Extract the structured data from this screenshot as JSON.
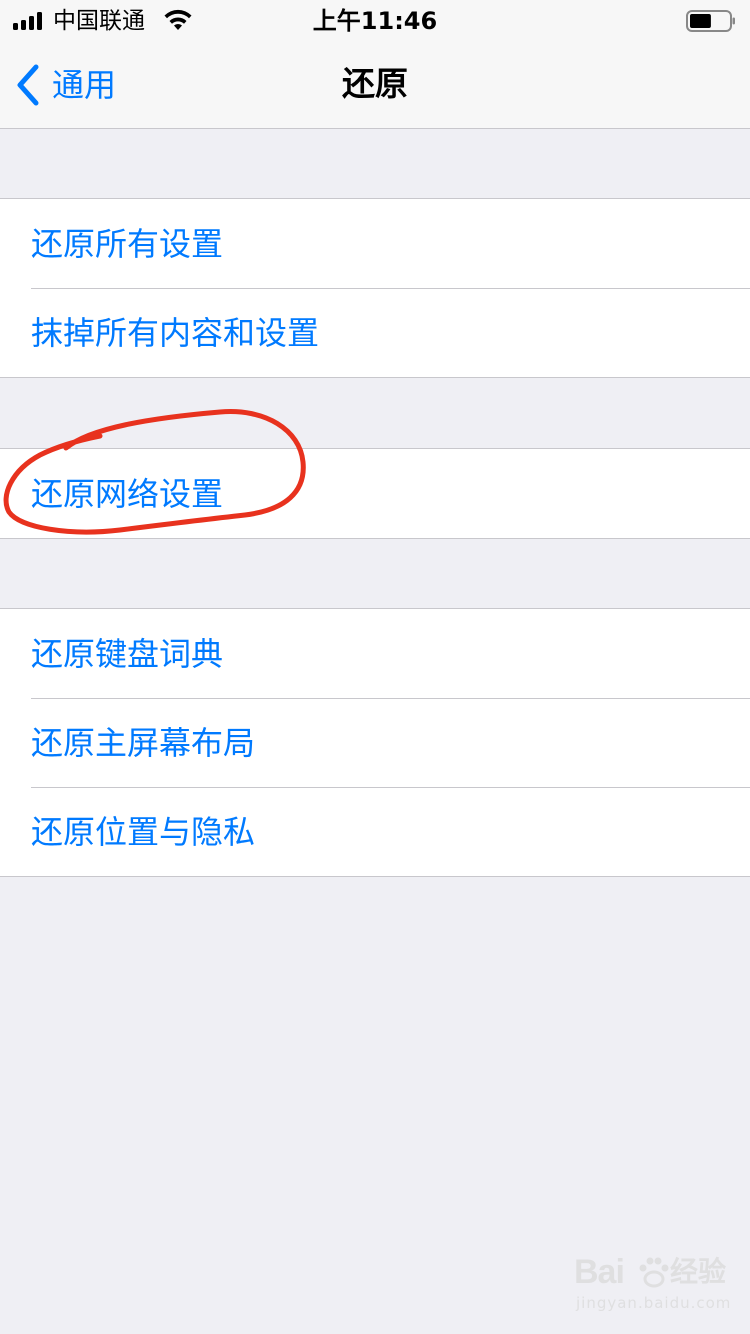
{
  "status_bar": {
    "carrier": "中国联通",
    "time": "上午11:46",
    "signal_bars": 4,
    "battery_level": 0.55
  },
  "nav": {
    "back_label": "通用",
    "title": "还原"
  },
  "groups": [
    {
      "items": [
        {
          "label": "还原所有设置"
        },
        {
          "label": "抹掉所有内容和设置"
        }
      ]
    },
    {
      "items": [
        {
          "label": "还原网络设置"
        }
      ]
    },
    {
      "items": [
        {
          "label": "还原键盘词典"
        },
        {
          "label": "还原主屏幕布局"
        },
        {
          "label": "还原位置与隐私"
        }
      ]
    }
  ],
  "watermark": {
    "logo": "Bai",
    "logo_suffix": "经验",
    "url": "jingyan.baidu.com"
  },
  "colors": {
    "accent": "#007AFF",
    "background": "#EFEFF4",
    "annotation": "#E8321E"
  },
  "icons": [
    "back-chevron-icon",
    "cellular-signal-icon",
    "wifi-icon",
    "battery-icon"
  ]
}
